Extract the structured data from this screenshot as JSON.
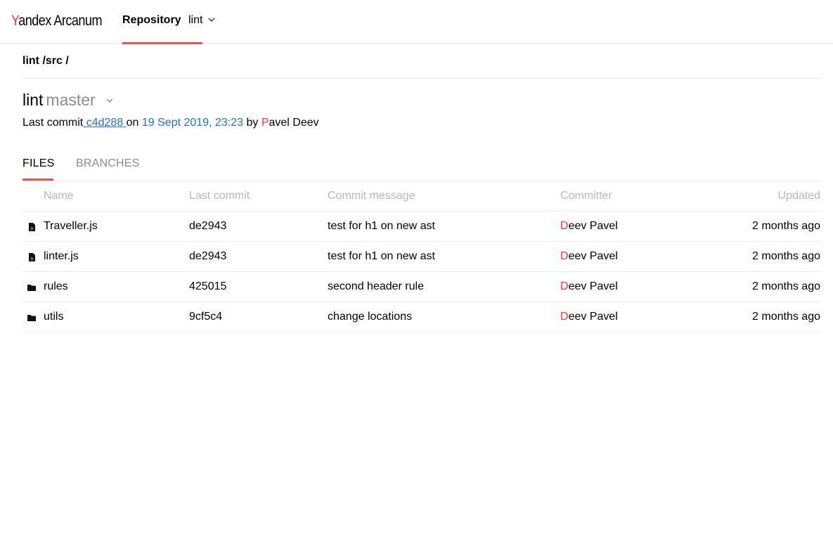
{
  "brand": {
    "logo_first": "Y",
    "logo_rest": "andex Arcanum",
    "accent": "#f33333"
  },
  "nav": {
    "tab_label": "Repository",
    "repo_value": "lint",
    "chevron_icon": "chevron-down-icon",
    "underline_color": "#e5574d"
  },
  "breadcrumb": {
    "part1": "lint",
    "part2": " /src",
    "part3": " /"
  },
  "repo": {
    "name": "lint",
    "branch": "master"
  },
  "last_commit": {
    "prefix": "Last commit",
    "hash": " c4d288 ",
    "on": "on ",
    "date": "19 Sept 2019, 23:23",
    "by": " by ",
    "author_initial": "P",
    "author_rest": "avel Deev"
  },
  "tabs": {
    "files": "FILES",
    "branches": "BRANCHES"
  },
  "table": {
    "headers": {
      "name": "Name",
      "last_commit": "Last commit",
      "message": "Commit message",
      "committer": "Committer",
      "updated": "Updated"
    },
    "rows": [
      {
        "icon": "js-file-icon",
        "name": "Traveller.js",
        "commit": "de2943",
        "message": "test for h1 on new ast",
        "committer_initial": "D",
        "committer_rest": "eev Pavel",
        "updated": "2 months ago"
      },
      {
        "icon": "js-file-icon",
        "name": "linter.js",
        "commit": "de2943",
        "message": "test for h1 on new ast",
        "committer_initial": "D",
        "committer_rest": "eev Pavel",
        "updated": "2 months ago"
      },
      {
        "icon": "folder-icon",
        "name": "rules",
        "commit": "425015",
        "message": "second header rule",
        "committer_initial": "D",
        "committer_rest": "eev Pavel",
        "updated": "2 months ago"
      },
      {
        "icon": "folder-icon",
        "name": "utils",
        "commit": "9cf5c4",
        "message": "change locations",
        "committer_initial": "D",
        "committer_rest": "eev Pavel",
        "updated": "2 months ago"
      }
    ]
  },
  "colors": {
    "link": "#1f6fd1",
    "muted": "#8c8c8c",
    "header_text": "#b8b8b8"
  }
}
